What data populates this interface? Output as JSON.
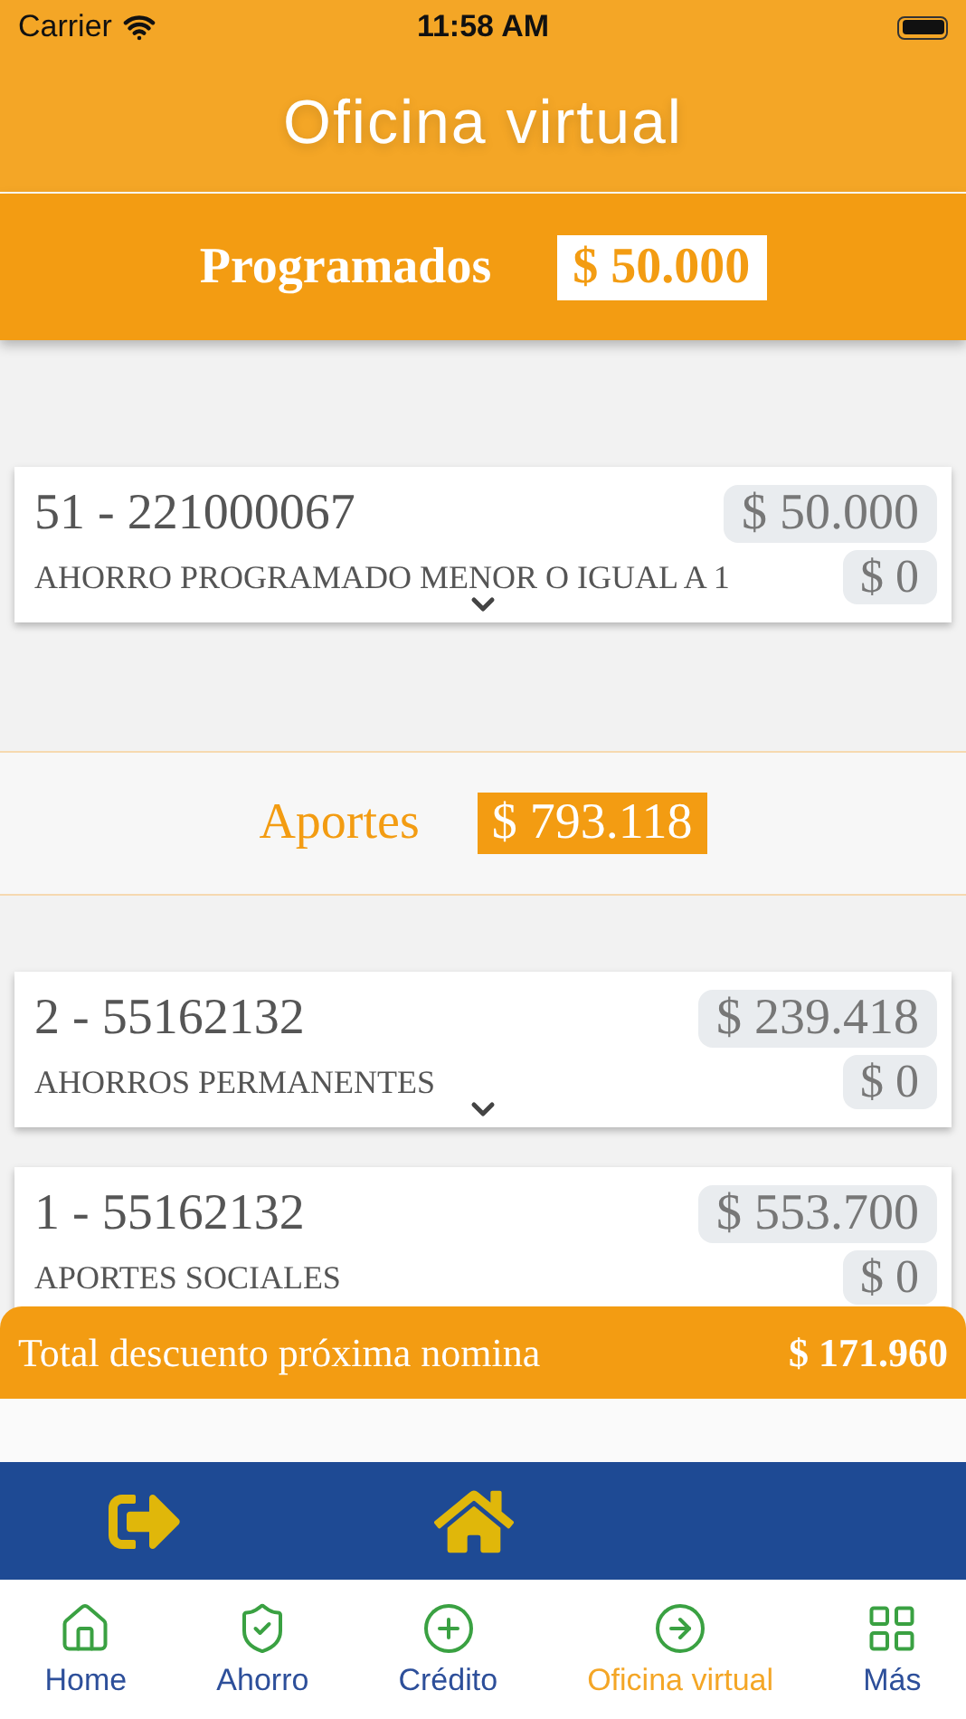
{
  "status_bar": {
    "carrier": "Carrier",
    "time": "11:58 AM"
  },
  "header": {
    "title": "Oficina virtual"
  },
  "sections": [
    {
      "kind": "band",
      "title": "Programados",
      "total": "$ 50.000",
      "accounts": [
        {
          "number": "51 - 221000067",
          "balance": "$ 50.000",
          "name": "AHORRO PROGRAMADO MENOR O IGUAL A 1",
          "discount": "$ 0"
        }
      ]
    },
    {
      "kind": "plain",
      "title": "Aportes",
      "total": "$ 793.118",
      "accounts": [
        {
          "number": "2 - 55162132",
          "balance": "$ 239.418",
          "name": "AHORROS PERMANENTES",
          "discount": "$ 0"
        },
        {
          "number": "1 - 55162132",
          "balance": "$ 553.700",
          "name": "APORTES SOCIALES",
          "discount": "$ 0"
        }
      ]
    }
  ],
  "total_bar": {
    "label": "Total descuento próxima nomina",
    "value": "$ 171.960"
  },
  "tab_bar": [
    {
      "label": "Home",
      "selected": false
    },
    {
      "label": "Ahorro",
      "selected": false
    },
    {
      "label": "Crédito",
      "selected": false
    },
    {
      "label": "Oficina virtual",
      "selected": true
    },
    {
      "label": "Más",
      "selected": false
    }
  ]
}
